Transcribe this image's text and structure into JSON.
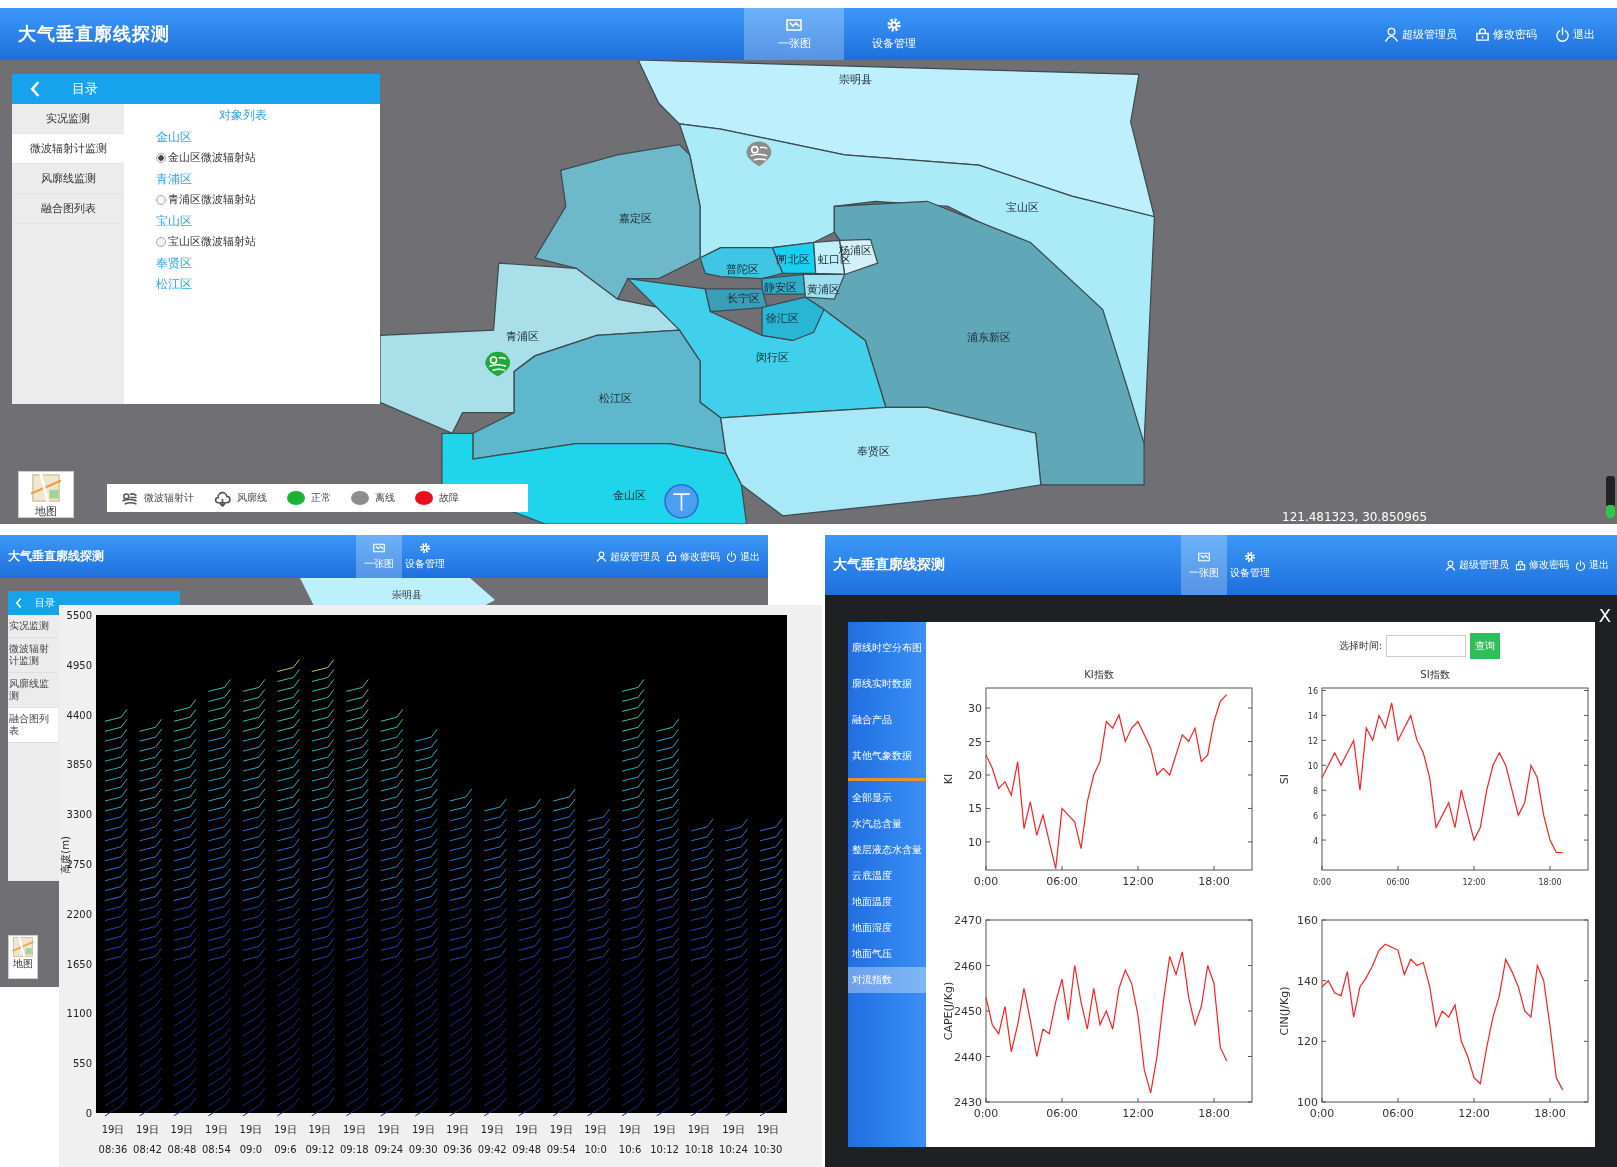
{
  "main_view": {
    "header": {
      "title": "大气垂直廓线探测",
      "tabs": [
        {
          "label": "一张图",
          "selected": true
        },
        {
          "label": "设备管理",
          "selected": false
        }
      ],
      "user_menu": [
        "超级管理员",
        "修改密码",
        "退出"
      ]
    },
    "sidebar": {
      "title": "目录",
      "nav": [
        {
          "label": "实况监测",
          "selected": false
        },
        {
          "label": "微波辐射计监测",
          "selected": true
        },
        {
          "label": "风廓线监测",
          "selected": false
        },
        {
          "label": "融合图列表",
          "selected": false
        }
      ],
      "list_title": "对象列表",
      "groups": [
        {
          "name": "金山区",
          "stations": [
            {
              "name": "金山区微波辐射站",
              "selected": true
            }
          ]
        },
        {
          "name": "青浦区",
          "stations": [
            {
              "name": "青浦区微波辐射站",
              "selected": false
            }
          ]
        },
        {
          "name": "宝山区",
          "stations": [
            {
              "name": "宝山区微波辐射站",
              "selected": false
            }
          ]
        },
        {
          "name": "奉贤区"
        },
        {
          "name": "松江区"
        }
      ]
    },
    "map": {
      "districts": [
        {
          "name": "崇明县",
          "color": "#bdf0fc"
        },
        {
          "name": "宝山区",
          "color": "#abeaf7"
        },
        {
          "name": "嘉定区",
          "color": "#6db8c9"
        },
        {
          "name": "杨浦区",
          "color": "#d5f1f8"
        },
        {
          "name": "闸北区",
          "color": "#19d0f0"
        },
        {
          "name": "虹口区",
          "color": "#bff0fb"
        },
        {
          "name": "普陀区",
          "color": "#3fc6e5"
        },
        {
          "name": "静安区",
          "color": "#2eaecb"
        },
        {
          "name": "黄浦区",
          "color": "#9fdff0"
        },
        {
          "name": "长宁区",
          "color": "#3b9db6"
        },
        {
          "name": "徐汇区",
          "color": "#29b5d4"
        },
        {
          "name": "浦东新区",
          "color": "#60a8b8"
        },
        {
          "name": "青浦区",
          "color": "#a9dfe9"
        },
        {
          "name": "闵行区",
          "color": "#40d0ec"
        },
        {
          "name": "松江区",
          "color": "#5eb7cc"
        },
        {
          "name": "奉贤区",
          "color": "#a9e8f6"
        },
        {
          "name": "金山区",
          "color": "#20d4ec"
        }
      ],
      "markers": [
        {
          "kind": "radiometer",
          "color": "#8c8c8c"
        },
        {
          "kind": "radiometer",
          "color": "#1faa35"
        },
        {
          "kind": "profiler",
          "color": "#4a9ff0"
        }
      ],
      "map_button": "地图",
      "legend": [
        {
          "kind": "radiometer",
          "label": "微波辐射计"
        },
        {
          "kind": "profiler",
          "label": "风廓线"
        },
        {
          "kind": "status",
          "color": "#19b434",
          "label": "正常"
        },
        {
          "kind": "status",
          "color": "#8c8c8c",
          "label": "离线"
        },
        {
          "kind": "status",
          "color": "#e8101a",
          "label": "故障"
        }
      ],
      "coordinates": "121.481323, 30.850965",
      "zoom_slider": {
        "level": 0.3
      }
    }
  },
  "wind_view": {
    "header": {
      "title": "大气垂直廓线探测",
      "tabs": [
        {
          "label": "一张图",
          "selected": true
        },
        {
          "label": "设备管理",
          "selected": false
        }
      ],
      "user_menu": [
        "超级管理员",
        "修改密码",
        "退出"
      ]
    },
    "map_label": "崇明县",
    "sidebar": {
      "title": "目录",
      "nav": [
        {
          "label": "实况监测",
          "selected": false
        },
        {
          "label": "微波辐射计监测",
          "selected": false
        },
        {
          "label": "风廓线监测",
          "selected": false
        },
        {
          "label": "融合图列表",
          "selected": true
        }
      ]
    },
    "map_button": "地图",
    "wind_chart": {
      "ylabel": "高度(m)",
      "yticks": [
        "5500",
        "4950",
        "4400",
        "3850",
        "3300",
        "2750",
        "2200",
        "1650",
        "1100",
        "550",
        "0"
      ],
      "xticks": [
        {
          "day": "19日",
          "time": "08:36"
        },
        {
          "day": "19日",
          "time": "08:42"
        },
        {
          "day": "19日",
          "time": "08:48"
        },
        {
          "day": "19日",
          "time": "08:54"
        },
        {
          "day": "19日",
          "time": "09:0"
        },
        {
          "day": "19日",
          "time": "09:6"
        },
        {
          "day": "19日",
          "time": "09:12"
        },
        {
          "day": "19日",
          "time": "09:18"
        },
        {
          "day": "19日",
          "time": "09:24"
        },
        {
          "day": "19日",
          "time": "09:30"
        },
        {
          "day": "19日",
          "time": "09:36"
        },
        {
          "day": "19日",
          "time": "09:42"
        },
        {
          "day": "19日",
          "time": "09:48"
        },
        {
          "day": "19日",
          "time": "09:54"
        },
        {
          "day": "19日",
          "time": "10:0"
        },
        {
          "day": "19日",
          "time": "10:6"
        },
        {
          "day": "19日",
          "time": "10:12"
        },
        {
          "day": "19日",
          "time": "10:18"
        },
        {
          "day": "19日",
          "time": "10:24"
        },
        {
          "day": "19日",
          "time": "10:30"
        }
      ]
    }
  },
  "index_view": {
    "header": {
      "title": "大气垂直廓线探测",
      "tabs": [
        {
          "label": "一张图",
          "selected": true
        },
        {
          "label": "设备管理",
          "selected": false
        }
      ],
      "user_menu": [
        "超级管理员",
        "修改密码",
        "退出"
      ]
    },
    "close": "X",
    "menu": [
      {
        "kind": "group",
        "label": "廓线时空分布图",
        "selected": false
      },
      {
        "kind": "group",
        "label": "廓线实时数据",
        "selected": false
      },
      {
        "kind": "group",
        "label": "融合产品",
        "selected": false
      },
      {
        "kind": "group",
        "label": "其他气象数据",
        "selected": false
      },
      {
        "kind": "item",
        "label": "全部显示",
        "selected": false
      },
      {
        "kind": "item",
        "label": "水汽总含量",
        "selected": false
      },
      {
        "kind": "item",
        "label": "整层液态水含量",
        "selected": false
      },
      {
        "kind": "item",
        "label": "云底温度",
        "selected": false
      },
      {
        "kind": "item",
        "label": "地面温度",
        "selected": false
      },
      {
        "kind": "item",
        "label": "地面湿度",
        "selected": false
      },
      {
        "kind": "item",
        "label": "地面气压",
        "selected": false
      },
      {
        "kind": "item",
        "label": "对流指数",
        "selected": true
      }
    ],
    "time_label": "选择时间:",
    "query_button": "查询",
    "charts": [
      {
        "chart_data": {
          "type": "line",
          "title": "KI指数",
          "ylabel": "KI",
          "xlim": [
            0,
            21
          ],
          "ylim": [
            5.8,
            33
          ],
          "xticks": [
            {
              "value": 0,
              "label": "0:00"
            },
            {
              "value": 6,
              "label": "06:00"
            },
            {
              "value": 12,
              "label": "12:00"
            },
            {
              "value": 18,
              "label": "18:00"
            }
          ],
          "yticks": [
            10,
            15,
            20,
            25,
            30
          ],
          "x": [
            0,
            0.5,
            1,
            1.5,
            2,
            2.5,
            3,
            3.5,
            4,
            4.5,
            5,
            5.5,
            6,
            6.5,
            7,
            7.5,
            8,
            8.5,
            9,
            9.5,
            10,
            10.5,
            11,
            11.5,
            12,
            12.5,
            13,
            13.5,
            14,
            14.5,
            15,
            15.5,
            16,
            16.5,
            17,
            17.5,
            18,
            18.5,
            19
          ],
          "series": [
            {
              "color": "#ff2020",
              "values": [
                23,
                21,
                18,
                19,
                17,
                22,
                12,
                16,
                11,
                14,
                10,
                6,
                15,
                14,
                13,
                9,
                16,
                20,
                22,
                28,
                27,
                29,
                25,
                27,
                28,
                26,
                24,
                20,
                21,
                20,
                23,
                26,
                25,
                27,
                22,
                23,
                28,
                31,
                32
              ]
            }
          ]
        }
      },
      {
        "chart_data": {
          "type": "line",
          "title": "SI指数",
          "ylabel": "SI",
          "xlim": [
            0,
            21
          ],
          "ylim": [
            1.6,
            16.2
          ],
          "xticks": [
            {
              "value": 0,
              "label": "0:00"
            },
            {
              "value": 6,
              "label": "06:00"
            },
            {
              "value": 12,
              "label": "12:00"
            },
            {
              "value": 18,
              "label": "18:00"
            }
          ],
          "yticks": [
            4,
            6,
            8,
            10,
            12,
            14,
            16
          ],
          "x": [
            0,
            0.5,
            1,
            1.5,
            2,
            2.5,
            3,
            3.5,
            4,
            4.5,
            5,
            5.5,
            6,
            6.5,
            7,
            7.5,
            8,
            8.5,
            9,
            9.5,
            10,
            10.5,
            11,
            11.5,
            12,
            12.5,
            13,
            13.5,
            14,
            14.5,
            15,
            15.5,
            16,
            16.5,
            17,
            17.5,
            18,
            18.5,
            19
          ],
          "series": [
            {
              "color": "#ff2020",
              "values": [
                9,
                10,
                11,
                10,
                11,
                12,
                8,
                13,
                12,
                14,
                13,
                15,
                12,
                13,
                14,
                12,
                11,
                9,
                5,
                6,
                7,
                5,
                8,
                6,
                4,
                5,
                8,
                10,
                11,
                10,
                8,
                6,
                7,
                10,
                9,
                6,
                4,
                3,
                3
              ]
            }
          ]
        }
      },
      {
        "chart_data": {
          "type": "line",
          "ylabel": "CAPE(J/Kg)",
          "xlim": [
            0,
            21
          ],
          "ylim": [
            2430,
            2470
          ],
          "xticks": [
            {
              "value": 0,
              "label": "0:00"
            },
            {
              "value": 6,
              "label": "06:00"
            },
            {
              "value": 12,
              "label": "12:00"
            },
            {
              "value": 18,
              "label": "18:00"
            }
          ],
          "yticks": [
            2430,
            2440,
            2450,
            2460,
            2470
          ],
          "x": [
            0,
            0.5,
            1,
            1.5,
            2,
            2.5,
            3,
            3.5,
            4,
            4.5,
            5,
            5.5,
            6,
            6.5,
            7,
            7.5,
            8,
            8.5,
            9,
            9.5,
            10,
            10.5,
            11,
            11.5,
            12,
            12.5,
            13,
            13.5,
            14,
            14.5,
            15,
            15.5,
            16,
            16.5,
            17,
            17.5,
            18,
            18.5,
            19
          ],
          "series": [
            {
              "color": "#ff2020",
              "values": [
                2453,
                2447,
                2445,
                2451,
                2441,
                2447,
                2455,
                2448,
                2440,
                2446,
                2445,
                2452,
                2457,
                2448,
                2460,
                2452,
                2446,
                2455,
                2447,
                2450,
                2446,
                2455,
                2459,
                2456,
                2449,
                2437,
                2432,
                2440,
                2452,
                2462,
                2458,
                2463,
                2453,
                2447,
                2451,
                2460,
                2456,
                2442,
                2439
              ]
            }
          ]
        }
      },
      {
        "chart_data": {
          "type": "line",
          "ylabel": "CIN(J/Kg)",
          "xlim": [
            0,
            21
          ],
          "ylim": [
            100,
            160
          ],
          "xticks": [
            {
              "value": 0,
              "label": "0:00"
            },
            {
              "value": 6,
              "label": "06:00"
            },
            {
              "value": 12,
              "label": "12:00"
            },
            {
              "value": 18,
              "label": "18:00"
            }
          ],
          "yticks": [
            100,
            120,
            140,
            160
          ],
          "x": [
            0,
            0.5,
            1,
            1.5,
            2,
            2.5,
            3,
            3.5,
            4,
            4.5,
            5,
            5.5,
            6,
            6.5,
            7,
            7.5,
            8,
            8.5,
            9,
            9.5,
            10,
            10.5,
            11,
            11.5,
            12,
            12.5,
            13,
            13.5,
            14,
            14.5,
            15,
            15.5,
            16,
            16.5,
            17,
            17.5,
            18,
            18.5,
            19
          ],
          "series": [
            {
              "color": "#ff2020",
              "values": [
                138,
                140,
                136,
                135,
                143,
                128,
                138,
                141,
                145,
                150,
                152,
                151,
                150,
                142,
                147,
                145,
                146,
                138,
                125,
                130,
                128,
                132,
                120,
                115,
                108,
                106,
                118,
                128,
                135,
                147,
                143,
                138,
                130,
                128,
                145,
                140,
                125,
                108,
                104
              ]
            }
          ]
        }
      }
    ]
  }
}
